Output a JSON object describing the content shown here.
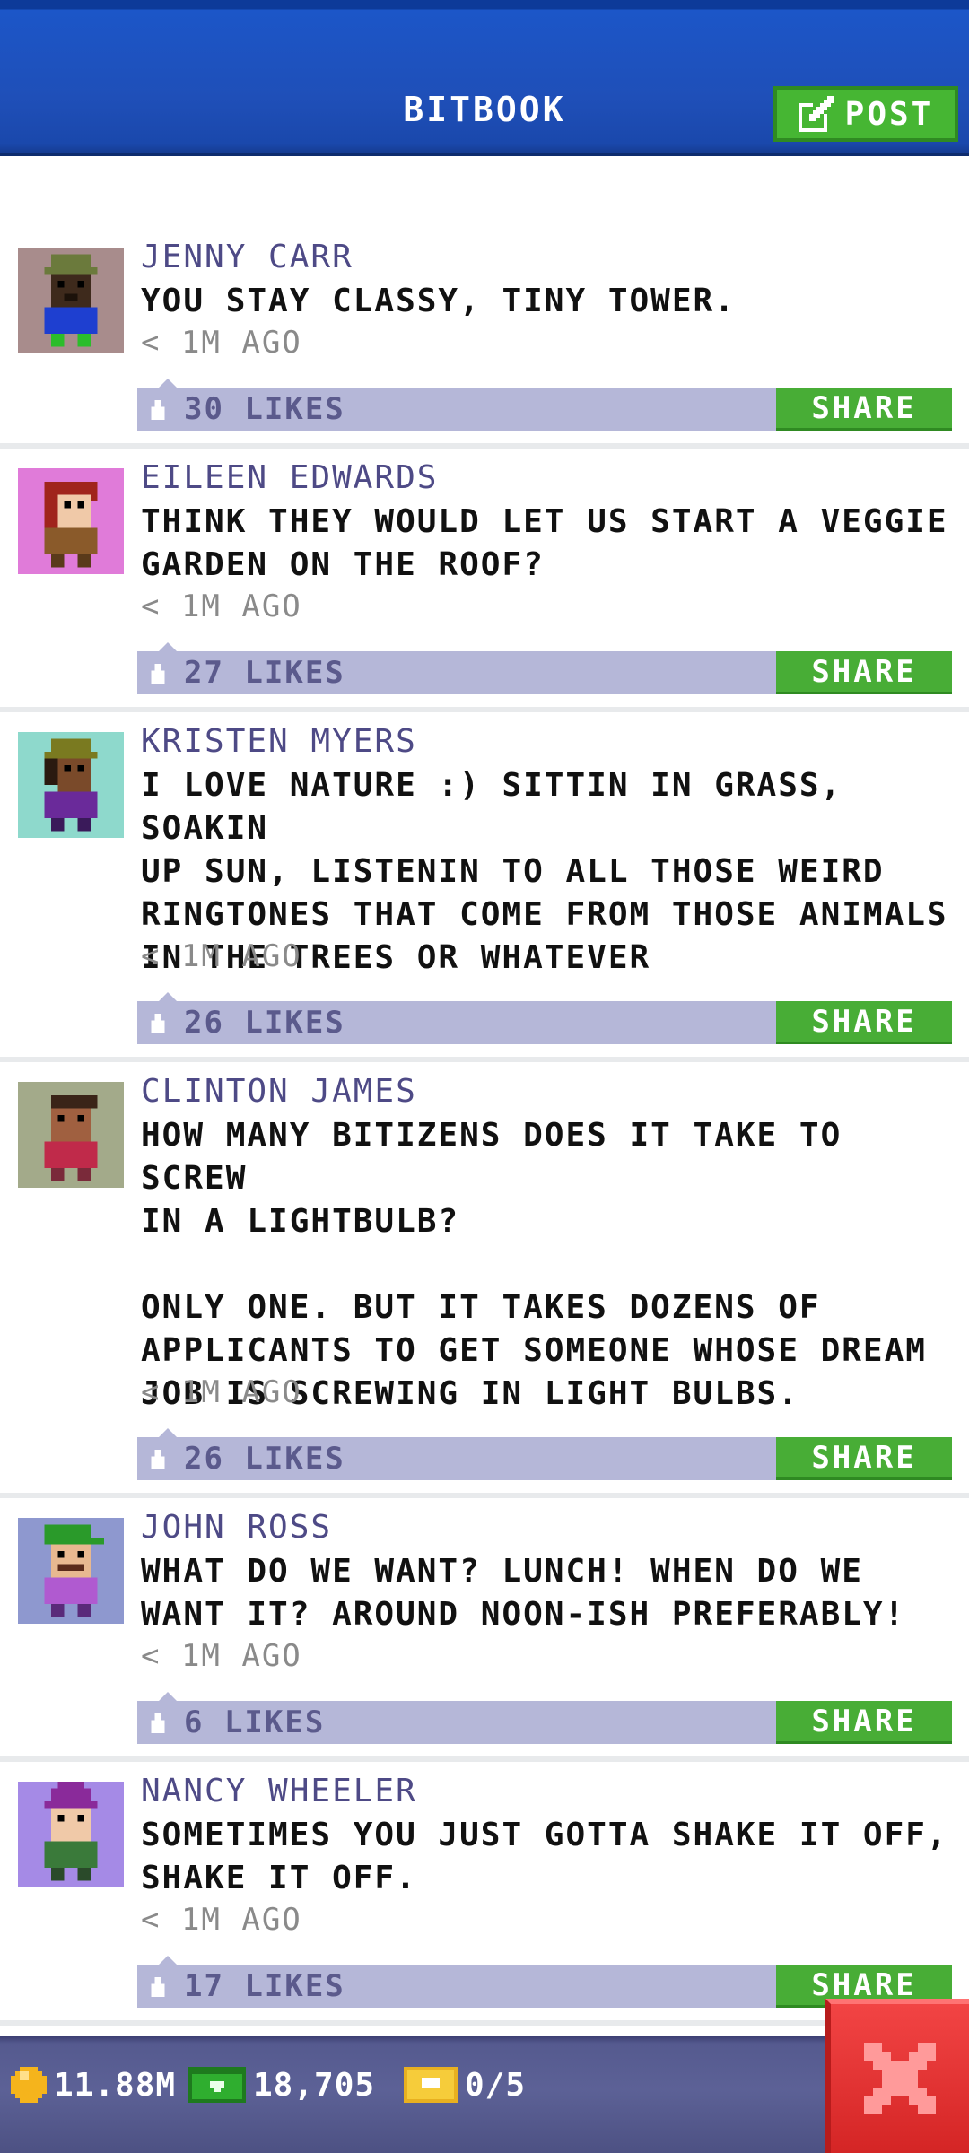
{
  "header": {
    "title": "BITBOOK",
    "post_label": "POST"
  },
  "posts": [
    {
      "name": "JENNY CARR",
      "message": "YOU STAY CLASSY, TINY TOWER.",
      "time": "< 1M AGO",
      "likes": "30 LIKES",
      "share": "SHARE",
      "avatar_bg": "#a88c8c"
    },
    {
      "name": "EILEEN EDWARDS",
      "message": "THINK THEY WOULD LET US START A VEGGIE\nGARDEN ON THE ROOF?",
      "time": "< 1M AGO",
      "likes": "27 LIKES",
      "share": "SHARE",
      "avatar_bg": "#e07bd9"
    },
    {
      "name": "KRISTEN MYERS",
      "message": "I LOVE NATURE :) SITTIN IN GRASS, SOAKIN\nUP SUN, LISTENIN TO ALL THOSE WEIRD\nRINGTONES THAT COME FROM THOSE ANIMALS\nIN THE TREES OR WHATEVER",
      "time": "< 1M AGO",
      "likes": "26 LIKES",
      "share": "SHARE",
      "avatar_bg": "#8ed9cc"
    },
    {
      "name": "CLINTON JAMES",
      "message": "HOW MANY BITIZENS DOES IT TAKE TO SCREW\nIN A LIGHTBULB?\n\nONLY ONE. BUT IT TAKES DOZENS OF\nAPPLICANTS TO GET SOMEONE WHOSE DREAM\nJOB IS SCREWING IN LIGHT BULBS.",
      "time": "< 1M AGO",
      "likes": "26 LIKES",
      "share": "SHARE",
      "avatar_bg": "#a3aa8a"
    },
    {
      "name": "JOHN ROSS",
      "message": "WHAT DO WE WANT? LUNCH! WHEN DO WE\nWANT IT? AROUND NOON-ISH PREFERABLY!",
      "time": "< 1M AGO",
      "likes": "6 LIKES",
      "share": "SHARE",
      "avatar_bg": "#8e98cf"
    },
    {
      "name": "NANCY WHEELER",
      "message": "SOMETIMES YOU JUST GOTTA SHAKE IT OFF,\nSHAKE IT OFF.",
      "time": "< 1M AGO",
      "likes": "17 LIKES",
      "share": "SHARE",
      "avatar_bg": "#a58ae6"
    }
  ],
  "status": {
    "coins": "11.88M",
    "bux": "18,705",
    "tickets": "0/5"
  },
  "colors": {
    "header_blue": "#1f4fb8",
    "green": "#46b633",
    "name_purple": "#4e4a86",
    "likes_bar": "#b5b7d8",
    "close_red": "#e43232"
  }
}
